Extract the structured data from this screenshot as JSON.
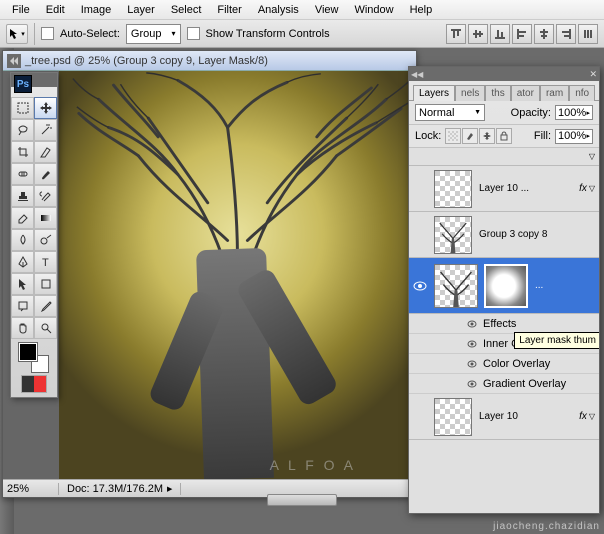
{
  "menu": {
    "items": [
      "File",
      "Edit",
      "Image",
      "Layer",
      "Select",
      "Filter",
      "Analysis",
      "View",
      "Window",
      "Help"
    ]
  },
  "options": {
    "auto_select_label": "Auto-Select:",
    "auto_select_value": "Group",
    "show_transform_label": "Show Transform Controls"
  },
  "document": {
    "title": "_tree.psd @ 25% (Group 3 copy 9, Layer Mask/8)",
    "zoom": "25%",
    "docinfo": "Doc: 17.3M/176.2M",
    "watermark": "A L F O A"
  },
  "panel": {
    "tabs": [
      "Layers",
      "nels",
      "ths",
      "ator",
      "ram",
      "nfo"
    ],
    "active_tab": 0,
    "blend_label": "Normal",
    "opacity_label": "Opacity:",
    "opacity_value": "100%",
    "lock_label": "Lock:",
    "fill_label": "Fill:",
    "fill_value": "100%",
    "tooltip": "Layer mask thum",
    "layers": [
      {
        "name": "Layer 10 ...",
        "fx": true
      },
      {
        "name": "Group 3 copy 8",
        "fx": false
      },
      {
        "name": "",
        "fx": false,
        "selected": true,
        "mask": true,
        "ellipsis": "..."
      },
      {
        "name": "Layer 10",
        "fx": true
      }
    ],
    "effects_label": "Effects",
    "effect_items": [
      "Inner Glow",
      "Color Overlay",
      "Gradient Overlay"
    ]
  },
  "footer_wm": "jiaocheng.chazidian"
}
